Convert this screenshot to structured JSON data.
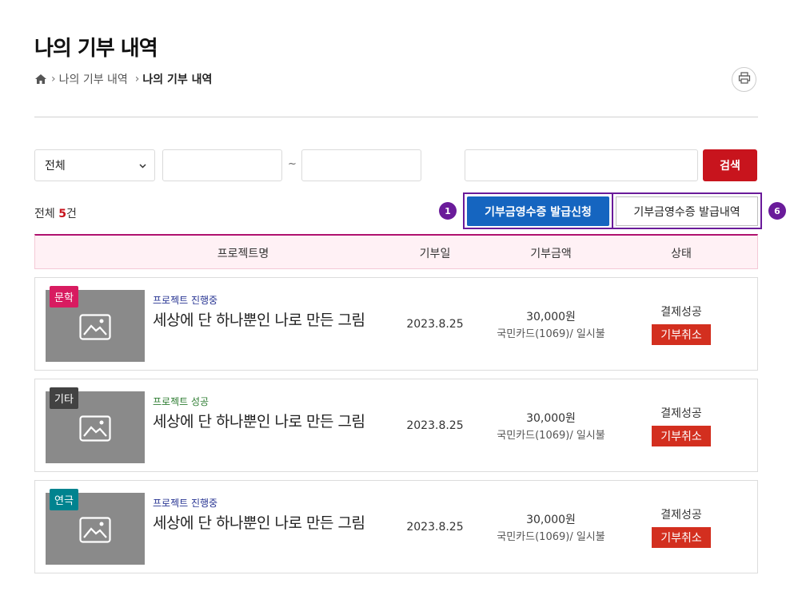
{
  "page_title": "나의 기부 내역",
  "breadcrumb": {
    "home_icon": "home-icon",
    "items": [
      "나의 기부 내역",
      "나의 기부 내역"
    ]
  },
  "print_icon": "print-icon",
  "filter": {
    "category_selected": "전체",
    "date_from": "",
    "date_to": "",
    "date_separator": "~",
    "keyword": "",
    "search_label": "검색"
  },
  "summary": {
    "prefix": "전체 ",
    "count": "5",
    "suffix": "건"
  },
  "markers": {
    "apply": "1",
    "history": "6"
  },
  "receipt": {
    "apply_label": "기부금영수증 발급신청",
    "history_label": "기부금영수증 발급내역"
  },
  "table": {
    "headers": [
      "프로젝트명",
      "기부일",
      "기부금액",
      "상태"
    ]
  },
  "rows": [
    {
      "category": "문학",
      "category_color": "#d81b60",
      "status_label": "프로젝트 진행중",
      "status_color": "#283593",
      "title": "세상에 단 하나뿐인 나로 만든 그림",
      "date": "2023.8.25",
      "amount": "30,000원",
      "payment": "국민카드(1069)/ 일시불",
      "payment_status": "결제성공",
      "cancel_label": "기부취소"
    },
    {
      "category": "기타",
      "category_color": "#424242",
      "status_label": "프로젝트 성공",
      "status_color": "#2e7d32",
      "title": "세상에 단 하나뿐인 나로 만든 그림",
      "date": "2023.8.25",
      "amount": "30,000원",
      "payment": "국민카드(1069)/ 일시불",
      "payment_status": "결제성공",
      "cancel_label": "기부취소"
    },
    {
      "category": "연극",
      "category_color": "#00838f",
      "status_label": "프로젝트 진행중",
      "status_color": "#283593",
      "title": "세상에 단 하나뿐인 나로 만든 그림",
      "date": "2023.8.25",
      "amount": "30,000원",
      "payment": "국민카드(1069)/ 일시불",
      "payment_status": "결제성공",
      "cancel_label": "기부취소"
    }
  ]
}
